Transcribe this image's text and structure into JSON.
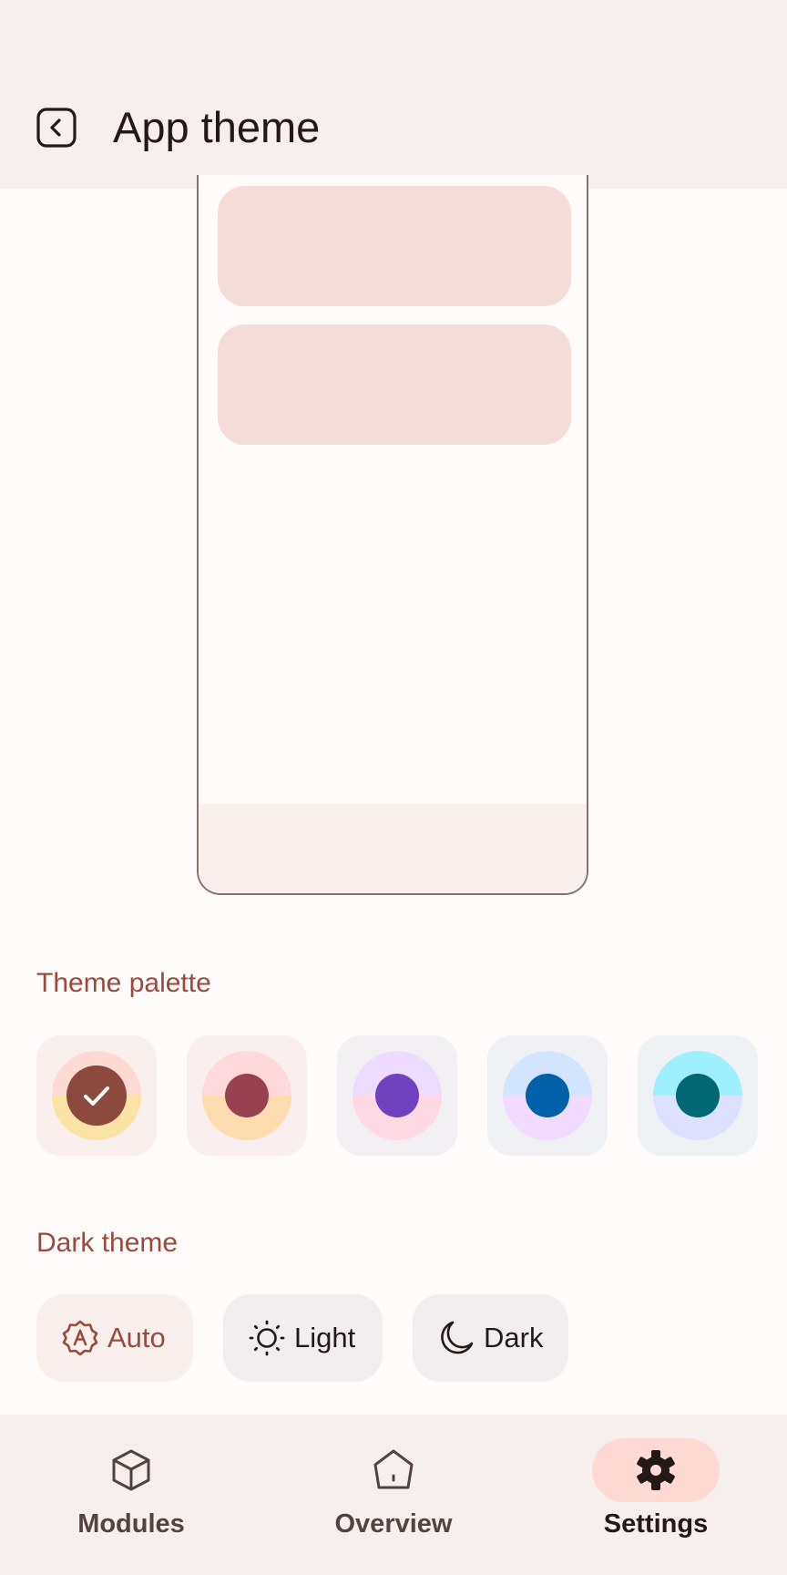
{
  "header": {
    "title": "App theme",
    "back_icon": "back-icon"
  },
  "theme_palette": {
    "title": "Theme palette",
    "swatches": [
      {
        "name": "palette-1",
        "top": "#ffdad4",
        "bottom": "#fbe3a6",
        "center": "#8b4a3b",
        "bg": "#f9efec",
        "selected": true
      },
      {
        "name": "palette-2",
        "top": "#ffd9db",
        "bottom": "#ffdcb0",
        "center": "#984150",
        "bg": "#f9efee",
        "selected": false
      },
      {
        "name": "palette-3",
        "top": "#eddcff",
        "bottom": "#ffd9e3",
        "center": "#6f43c0",
        "bg": "#f3f0f4",
        "selected": false
      },
      {
        "name": "palette-4",
        "top": "#d2e4ff",
        "bottom": "#f1dbff",
        "center": "#0060aa",
        "bg": "#eff1f5",
        "selected": false
      },
      {
        "name": "palette-5",
        "top": "#9eefff",
        "bottom": "#dde1ff",
        "center": "#006874",
        "bg": "#eff2f4",
        "selected": false
      }
    ]
  },
  "dark_theme": {
    "title": "Dark theme",
    "options": [
      {
        "label": "Auto",
        "icon": "auto-theme-icon",
        "selected": true
      },
      {
        "label": "Light",
        "icon": "sun-icon",
        "selected": false
      },
      {
        "label": "Dark",
        "icon": "moon-icon",
        "selected": false
      }
    ]
  },
  "bottom_nav": {
    "items": [
      {
        "label": "Modules",
        "icon": "cube-icon",
        "active": false
      },
      {
        "label": "Overview",
        "icon": "home-icon",
        "active": false
      },
      {
        "label": "Settings",
        "icon": "gear-icon",
        "active": true
      }
    ]
  },
  "colors": {
    "accent": "#9a4a3c",
    "selected_chip_bg": "#f9efec",
    "chip_bg": "#f2eeef",
    "active_nav_pill": "#ffdad4"
  }
}
